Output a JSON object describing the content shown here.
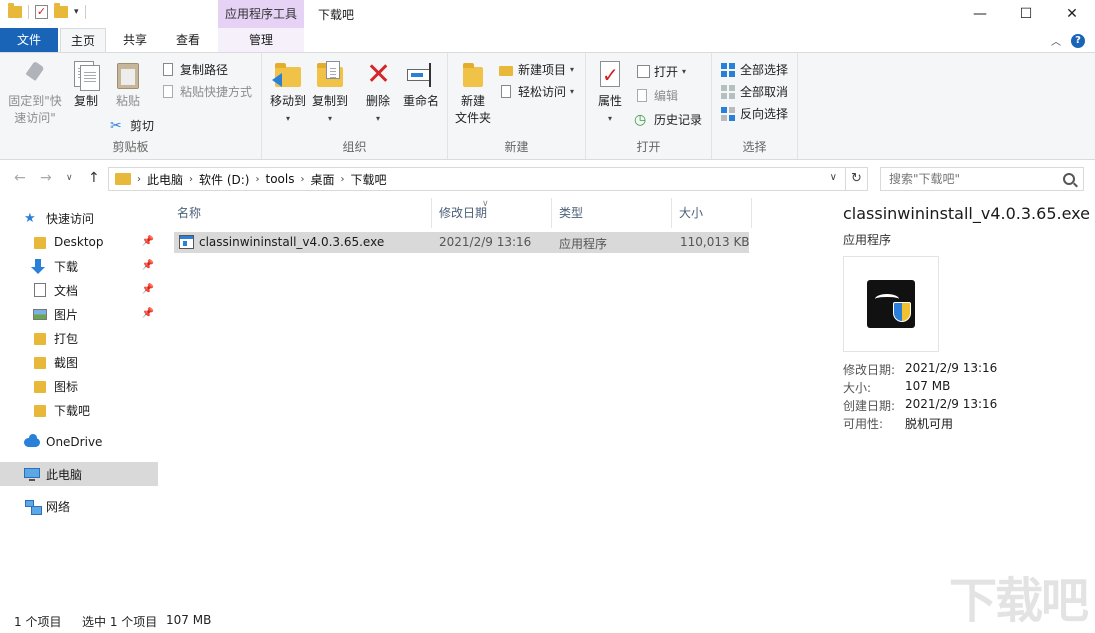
{
  "titlebar": {
    "context_tab": "应用程序工具",
    "window_title": "下载吧"
  },
  "tabs": {
    "file": "文件",
    "home": "主页",
    "share": "共享",
    "view": "查看",
    "manage": "管理"
  },
  "ribbon": {
    "clipboard": {
      "label": "剪贴板",
      "pin": [
        "固定到\"快",
        "速访问\""
      ],
      "copy": "复制",
      "paste": "粘贴",
      "copy_path": "复制路径",
      "paste_shortcut": "粘贴快捷方式",
      "cut": "剪切"
    },
    "organize": {
      "label": "组织",
      "move_to": "移动到",
      "copy_to": "复制到",
      "delete": "删除",
      "rename": "重命名"
    },
    "new": {
      "label": "新建",
      "new_folder": [
        "新建",
        "文件夹"
      ],
      "new_item": "新建项目",
      "easy_access": "轻松访问"
    },
    "open": {
      "label": "打开",
      "properties": "属性",
      "open": "打开",
      "edit": "编辑",
      "history": "历史记录"
    },
    "select": {
      "label": "选择",
      "select_all": "全部选择",
      "select_none": "全部取消",
      "invert": "反向选择"
    }
  },
  "address": {
    "crumbs": [
      "此电脑",
      "软件 (D:)",
      "tools",
      "桌面",
      "下载吧"
    ],
    "search_placeholder": "搜索\"下载吧\""
  },
  "nav": {
    "quick_access": "快速访问",
    "items": [
      {
        "label": "Desktop",
        "pinned": true
      },
      {
        "label": "下载",
        "pinned": true
      },
      {
        "label": "文档",
        "pinned": true
      },
      {
        "label": "图片",
        "pinned": true
      },
      {
        "label": "打包",
        "pinned": false
      },
      {
        "label": "截图",
        "pinned": false
      },
      {
        "label": "图标",
        "pinned": false
      },
      {
        "label": "下载吧",
        "pinned": false
      }
    ],
    "onedrive": "OneDrive",
    "this_pc": "此电脑",
    "network": "网络"
  },
  "filelist": {
    "columns": [
      "名称",
      "修改日期",
      "类型",
      "大小"
    ],
    "rows": [
      {
        "name": "classinwininstall_v4.0.3.65.exe",
        "date": "2021/2/9 13:16",
        "type": "应用程序",
        "size": "110,013 KB"
      }
    ]
  },
  "details": {
    "name": "classinwininstall_v4.0.3.65.exe",
    "type": "应用程序",
    "meta": [
      {
        "k": "修改日期:",
        "v": "2021/2/9 13:16"
      },
      {
        "k": "大小:",
        "v": "107 MB"
      },
      {
        "k": "创建日期:",
        "v": "2021/2/9 13:16"
      },
      {
        "k": "可用性:",
        "v": "脱机可用"
      }
    ]
  },
  "status": {
    "count": "1 个项目",
    "selected": "选中 1 个项目",
    "size": "107 MB"
  },
  "watermark": "下载吧"
}
